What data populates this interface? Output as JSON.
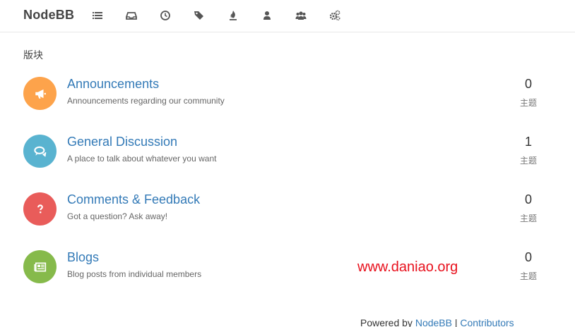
{
  "header": {
    "brand": "NodeBB",
    "nav_icons": [
      "list-icon",
      "inbox-icon",
      "clock-icon",
      "tags-icon",
      "fire-icon",
      "user-icon",
      "users-icon",
      "cogs-icon"
    ]
  },
  "breadcrumb": "版块",
  "categories": [
    {
      "title": "Announcements",
      "description": "Announcements regarding our community",
      "count": "0",
      "count_label": "主题",
      "color": "#fda34b",
      "icon": "bullhorn-icon"
    },
    {
      "title": "General Discussion",
      "description": "A place to talk about whatever you want",
      "count": "1",
      "count_label": "主题",
      "color": "#59b3d0",
      "icon": "comments-icon"
    },
    {
      "title": "Comments & Feedback",
      "description": "Got a question? Ask away!",
      "count": "0",
      "count_label": "主题",
      "color": "#e95c5a",
      "icon": "question-icon"
    },
    {
      "title": "Blogs",
      "description": "Blog posts from individual members",
      "count": "0",
      "count_label": "主题",
      "color": "#86ba4b",
      "icon": "newspaper-icon"
    }
  ],
  "watermark": "www.daniao.org",
  "footer": {
    "prefix": "Powered by ",
    "link1": "NodeBB",
    "separator": " | ",
    "link2": "Contributors"
  }
}
